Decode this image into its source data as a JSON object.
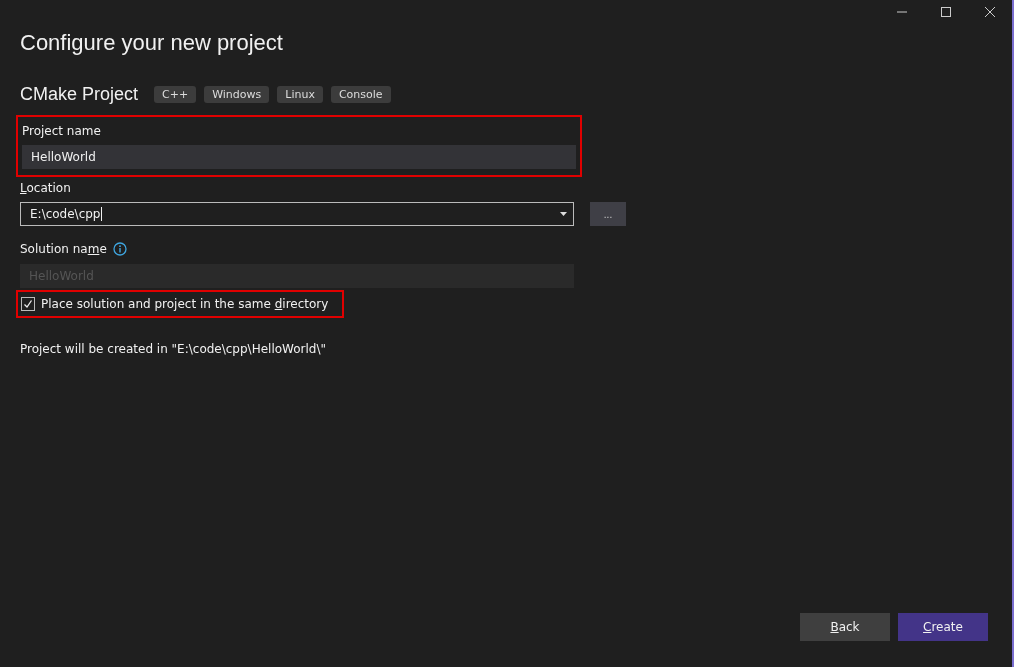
{
  "window": {
    "title": "Configure your new project"
  },
  "template": {
    "name": "CMake Project",
    "tags": [
      "C++",
      "Windows",
      "Linux",
      "Console"
    ]
  },
  "project_name": {
    "label": "Project name",
    "value": "HelloWorld",
    "highlighted": true
  },
  "location": {
    "label": [
      {
        "text": "L",
        "underlined": true
      },
      {
        "text": "ocation",
        "underlined": false
      }
    ],
    "value": "E:\\code\\cpp",
    "browse_label": "..."
  },
  "solution_name": {
    "label": [
      {
        "text": "Solution na",
        "underlined": false
      },
      {
        "text": "m",
        "underlined": true
      },
      {
        "text": "e",
        "underlined": false
      }
    ],
    "placeholder": "HelloWorld",
    "disabled": true
  },
  "same_directory": {
    "label": [
      {
        "text": "Place solution and project in the same ",
        "underlined": false
      },
      {
        "text": "d",
        "underlined": true
      },
      {
        "text": "irectory",
        "underlined": false
      }
    ],
    "checked": true,
    "highlighted": true
  },
  "summary": "Project will be created in \"E:\\code\\cpp\\HelloWorld\\\"",
  "buttons": [
    {
      "label": [
        {
          "text": "B",
          "underlined": true
        },
        {
          "text": "ack",
          "underlined": false
        }
      ],
      "kind": "secondary"
    },
    {
      "label": [
        {
          "text": "C",
          "underlined": true
        },
        {
          "text": "reate",
          "underlined": false
        }
      ],
      "kind": "primary"
    }
  ]
}
